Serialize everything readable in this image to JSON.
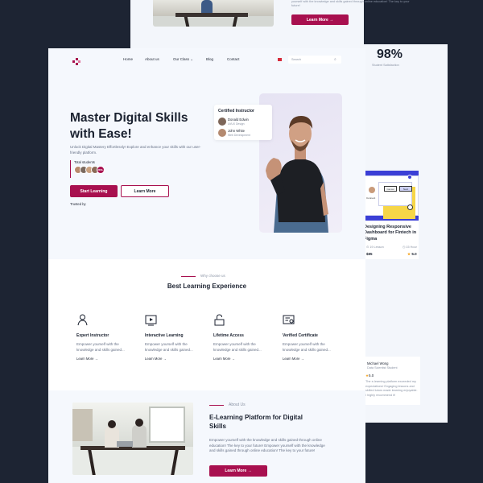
{
  "top_card": {
    "text": "yourself with the knowledge and skills gained through online education! The key to your future!",
    "button": "Learn More →"
  },
  "right_card": {
    "stat_value": "98%",
    "stat_label": "Student Satisfaction",
    "course": {
      "title": "Designing Responsive Dashboard for Fintech in Figma",
      "meta_left": "19 Lesson",
      "meta_right": "15 Hour",
      "price": "$85",
      "rating": "5.0",
      "mock_cancel": "Cancel",
      "mock_next": "Next",
      "mock_name": "Connect"
    },
    "testimonial": {
      "name": "Michael Wong",
      "role": "Data Scientist Student",
      "rating": "5.0",
      "quote": "The e-learning platform exceeded my expectations! Engaging lessons and skilled tutors made learning enjoyable. I highly recommend it!"
    }
  },
  "nav": {
    "links": [
      "Home",
      "About us",
      "Our Class",
      "Blog",
      "Contact"
    ],
    "search_placeholder": "Search"
  },
  "hero": {
    "title_line1": "Master Digital Skills",
    "title_line2": "with Ease!",
    "subtitle": "Unlock Digital Mastery Effortlessly! Explore and enhance your skills with our user-friendly platform.",
    "total_students_label": "Total students",
    "students_badge": "2000+",
    "start_button": "Start Learning",
    "learn_button": "Learn More",
    "trusted_label": "Trusted by",
    "instructor_card": {
      "title": "Certified Instructor",
      "people": [
        {
          "name": "Donald Edwin",
          "role": "UI/UX Design"
        },
        {
          "name": "John White",
          "role": "Web Development"
        }
      ]
    }
  },
  "why": {
    "kicker": "Why choose us",
    "title": "Best Learning Experience",
    "features": [
      {
        "icon": "instructor-icon",
        "title": "Expert Instructor",
        "desc": "Empower yourself with the knowledge and skills gained...",
        "link": "Learn More →"
      },
      {
        "icon": "video-play-icon",
        "title": "Interactive Learning",
        "desc": "Empower yourself with the knowledge and skills gained...",
        "link": "Learn More →"
      },
      {
        "icon": "unlock-icon",
        "title": "Lifetime Access",
        "desc": "Empower yourself with the knowledge and skills gained...",
        "link": "Learn More →"
      },
      {
        "icon": "certificate-icon",
        "title": "Verified Certificate",
        "desc": "Empower yourself with the knowledge and skills gained...",
        "link": "Learn More →"
      }
    ]
  },
  "about": {
    "kicker": "About Us",
    "title_line1": "E-Learning Platform for Digital",
    "title_line2": "Skills",
    "body": "Empower yourself with the knowledge and skills gained through online education! The key to your future! Empower yourself with the knowledge and skills gained through online education! The key to your future!",
    "button": "Learn More →"
  },
  "colors": {
    "accent": "#a8104f",
    "background": "#1d2433",
    "hero_bg": "#f5f8fd"
  }
}
